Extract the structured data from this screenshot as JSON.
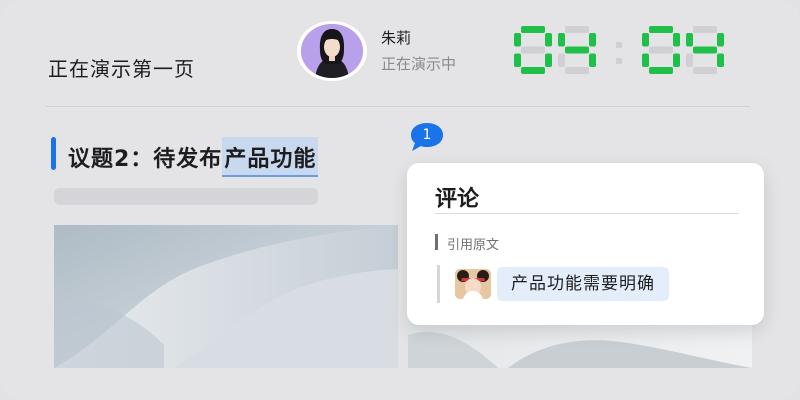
{
  "header": {
    "presenting_title": "正在演示第一页",
    "presenter": {
      "name": "朱莉",
      "status": "正在演示中"
    },
    "clock": {
      "time": "04:04",
      "color": "#1fbf4a"
    }
  },
  "agenda": {
    "prefix": "议题2：待发布",
    "highlight": "产品功能",
    "comment_count": "1",
    "accent": "#1a73e8"
  },
  "comment_card": {
    "title": "评论",
    "quote_label": "引用原文",
    "comment_text": "产品功能需要明确"
  },
  "icons": [
    "presenter-avatar",
    "comment-bubble-icon",
    "commenter-avatar"
  ]
}
